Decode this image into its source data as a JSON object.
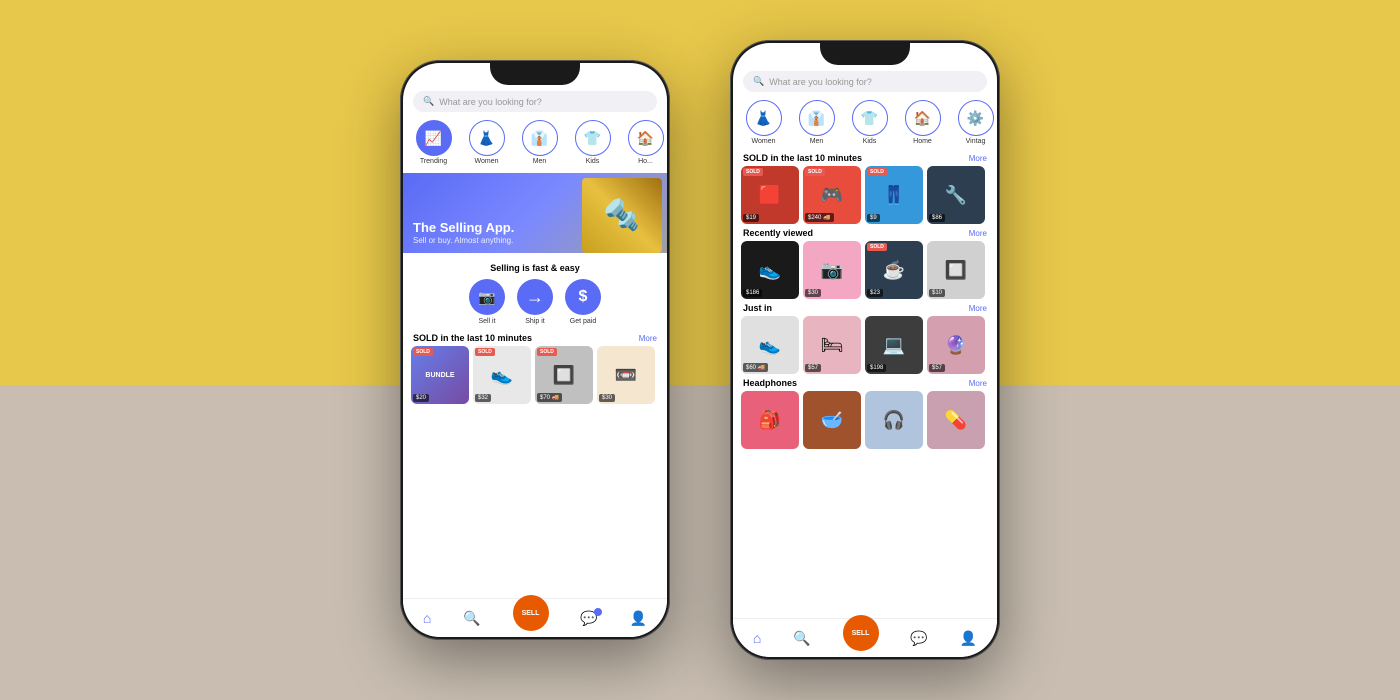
{
  "background": {
    "top_color": "#E8C84A",
    "bottom_color": "#C8BDB0"
  },
  "phone_left": {
    "search": {
      "placeholder": "What are you looking for?"
    },
    "categories": [
      {
        "label": "Trending",
        "icon": "📈",
        "active": true
      },
      {
        "label": "Women",
        "icon": "👗"
      },
      {
        "label": "Men",
        "icon": "👔"
      },
      {
        "label": "Kids",
        "icon": "👕"
      },
      {
        "label": "Ho...",
        "icon": "🏠"
      }
    ],
    "hero": {
      "title": "The Selling App.",
      "subtitle": "Sell or buy. Almost anything."
    },
    "fast_section": {
      "title": "Selling is fast & easy",
      "steps": [
        {
          "label": "Sell it",
          "icon": "📷"
        },
        {
          "label": "Ship it",
          "icon": "→"
        },
        {
          "label": "Get paid",
          "icon": "$"
        }
      ]
    },
    "sold_section": {
      "title": "SOLD in the last 10 minutes",
      "more_label": "More",
      "products": [
        {
          "emoji": "📦",
          "color": "bundle",
          "sold": true,
          "price": "$20",
          "ship": false
        },
        {
          "emoji": "👟",
          "color": "shoe",
          "sold": true,
          "price": "$32",
          "ship": false
        },
        {
          "emoji": "🔲",
          "color": "grey",
          "sold": true,
          "price": "$70",
          "ship": true
        },
        {
          "emoji": "📼",
          "color": "tape",
          "sold": false,
          "price": "$30",
          "ship": false
        }
      ]
    },
    "nav": {
      "items": [
        {
          "label": "home",
          "icon": "⌂",
          "active": true
        },
        {
          "label": "search",
          "icon": "🔍"
        },
        {
          "label": "sell",
          "icon": "SELL",
          "is_sell": true
        },
        {
          "label": "messages",
          "icon": "💬",
          "badge": true
        },
        {
          "label": "profile",
          "icon": "👤"
        }
      ]
    }
  },
  "phone_right": {
    "search": {
      "placeholder": "What are you looking for?"
    },
    "categories": [
      {
        "label": "Women",
        "icon": "👗"
      },
      {
        "label": "Men",
        "icon": "👔"
      },
      {
        "label": "Kids",
        "icon": "👕"
      },
      {
        "label": "Home",
        "icon": "🏠"
      },
      {
        "label": "Vintag",
        "icon": "⚙️"
      }
    ],
    "sold_section": {
      "title": "SOLD in the last 10 minutes",
      "more_label": "More",
      "products": [
        {
          "emoji": "🟥",
          "color": "plaid",
          "sold": true,
          "price": "$19",
          "ship": false
        },
        {
          "emoji": "🎮",
          "color": "game",
          "sold": true,
          "price": "$240",
          "ship": true
        },
        {
          "emoji": "👖",
          "color": "jeans",
          "sold": true,
          "price": "$9",
          "ship": false
        },
        {
          "emoji": "🔧",
          "color": "tool",
          "sold": false,
          "price": "$86",
          "ship": false
        }
      ]
    },
    "recently_viewed": {
      "title": "Recently viewed",
      "more_label": "More",
      "products": [
        {
          "emoji": "👟",
          "color": "sneaker",
          "sold": false,
          "price": "$186",
          "ship": false
        },
        {
          "emoji": "📷",
          "color": "camera",
          "sold": false,
          "price": "$30",
          "ship": false
        },
        {
          "emoji": "☕",
          "color": "coffee",
          "sold": true,
          "price": "$23",
          "ship": false
        },
        {
          "emoji": "🔲",
          "color": "cloth2",
          "sold": false,
          "price": "$10",
          "ship": false
        }
      ]
    },
    "just_in": {
      "title": "Just in",
      "more_label": "More",
      "products": [
        {
          "emoji": "👟",
          "color": "sneaker2",
          "sold": false,
          "price": "$60",
          "ship": true
        },
        {
          "emoji": "🛏",
          "color": "bedding",
          "sold": false,
          "price": "$57",
          "ship": false
        },
        {
          "emoji": "💻",
          "color": "tablet",
          "sold": false,
          "price": "$198",
          "ship": false
        },
        {
          "emoji": "🔮",
          "color": "misc",
          "sold": false,
          "price": "$57",
          "ship": false
        }
      ]
    },
    "headphones": {
      "title": "Headphones",
      "more_label": "More",
      "products": [
        {
          "emoji": "🎒",
          "color": "bag",
          "sold": false,
          "price": "",
          "ship": false
        },
        {
          "emoji": "🥣",
          "color": "bowl",
          "sold": false,
          "price": "",
          "ship": false
        },
        {
          "emoji": "🎧",
          "color": "headphone",
          "sold": false,
          "price": "",
          "ship": false
        },
        {
          "emoji": "💊",
          "color": "misc2",
          "sold": false,
          "price": "",
          "ship": false
        }
      ]
    },
    "nav": {
      "items": [
        {
          "label": "home",
          "icon": "⌂",
          "active": true
        },
        {
          "label": "search",
          "icon": "🔍"
        },
        {
          "label": "sell",
          "icon": "SELL",
          "is_sell": true
        },
        {
          "label": "messages",
          "icon": "💬"
        },
        {
          "label": "profile",
          "icon": "👤"
        }
      ]
    }
  }
}
